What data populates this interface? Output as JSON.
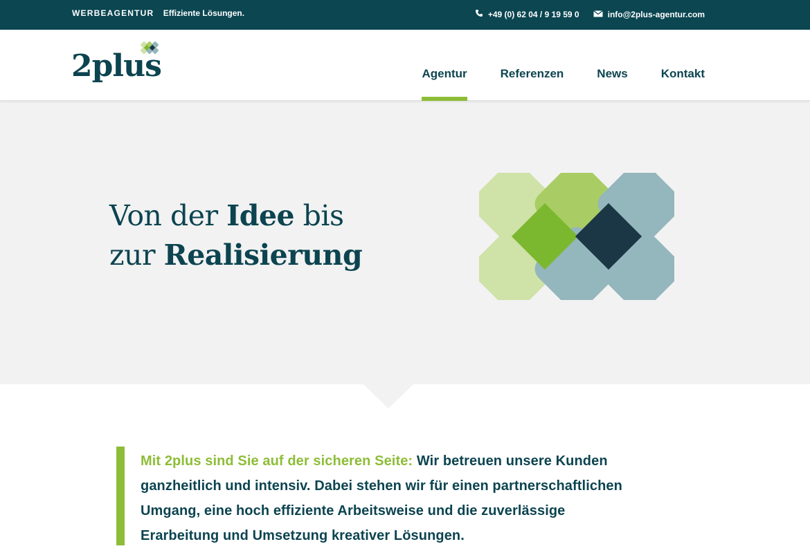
{
  "topbar": {
    "agency": "WERBEAGENTUR",
    "slogan": "Effiziente Lösungen.",
    "phone_icon": "phone-icon",
    "phone": "+49 (0) 62 04 / 9 19 59 0",
    "mail_icon": "mail-icon",
    "email": "info@2plus-agentur.com"
  },
  "header": {
    "logo_text": "2plus",
    "logo_icon": "x-mark-logo-icon"
  },
  "nav": {
    "items": [
      {
        "label": "Agentur",
        "active": true
      },
      {
        "label": "Referenzen",
        "active": false
      },
      {
        "label": "News",
        "active": false
      },
      {
        "label": "Kontakt",
        "active": false
      }
    ]
  },
  "hero": {
    "line1_pre": "Von der ",
    "line1_bold": "Idee",
    "line1_post": " bis",
    "line2_pre": "zur ",
    "line2_bold": "Realisierung",
    "graphic_icon": "x-mark-graphic"
  },
  "intro": {
    "lead": "Mit 2plus sind Sie auf der sicheren Seite:",
    "text": " Wir betreuen unsere Kunden ganzheitlich und intensiv. Dabei stehen wir für einen partnerschaftlichen Umgang, eine hoch effiziente Arbeitsweise und die zuverlässige Erarbeitung und Umsetzung kreativer Lösungen."
  },
  "colors": {
    "brand_dark": "#0b4651",
    "accent_green": "#8dbd38",
    "light_green": "#cfe2a8",
    "mid_green": "#a9cd64",
    "grey_blue": "#94b6bd",
    "dark_navy": "#1b3644",
    "hero_bg": "#f2f2f2"
  }
}
